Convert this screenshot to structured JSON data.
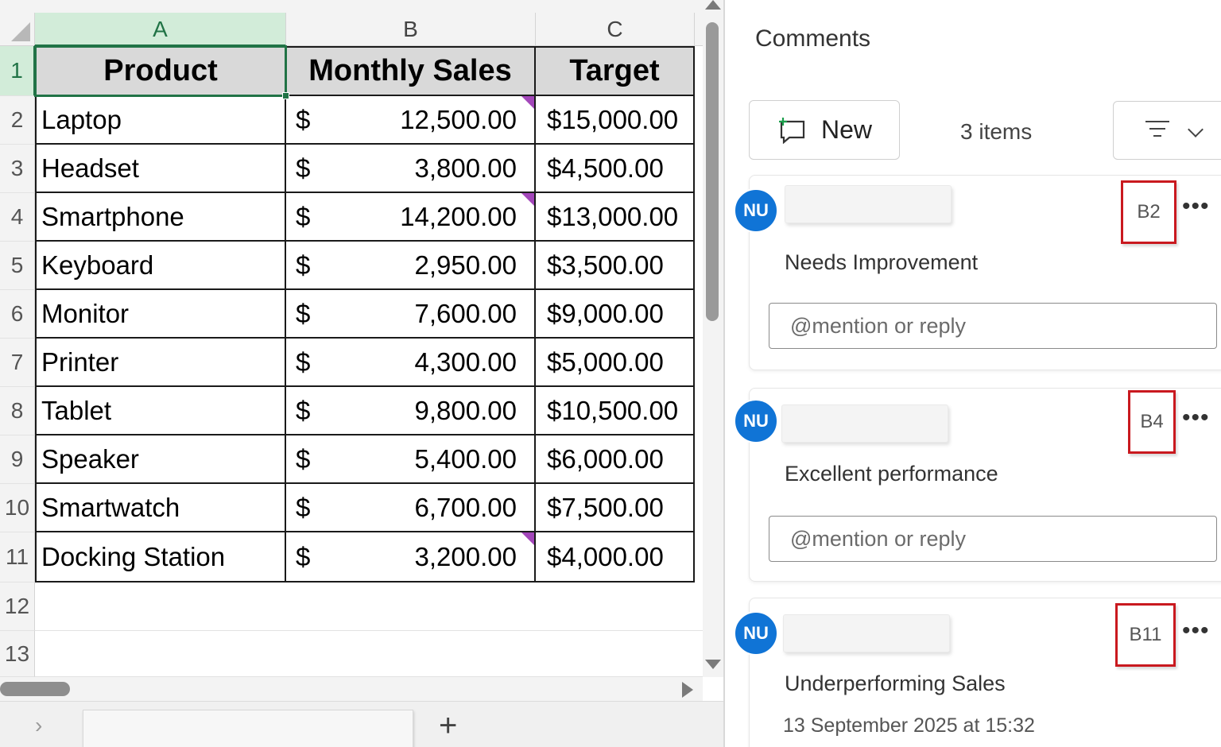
{
  "sheet": {
    "columns": [
      "A",
      "B",
      "C"
    ],
    "selected_column": "A",
    "selected_row": "1",
    "rows": [
      "1",
      "2",
      "3",
      "4",
      "5",
      "6",
      "7",
      "8",
      "9",
      "10",
      "11",
      "12",
      "13"
    ],
    "headers": [
      "Product",
      "Monthly Sales",
      "Target"
    ],
    "data": [
      {
        "product": "Laptop",
        "currency": "$",
        "sales": "12,500.00",
        "target": "$15,000.00",
        "has_comment": true
      },
      {
        "product": "Headset",
        "currency": "$",
        "sales": "3,800.00",
        "target": "$4,500.00",
        "has_comment": false
      },
      {
        "product": "Smartphone",
        "currency": "$",
        "sales": "14,200.00",
        "target": "$13,000.00",
        "has_comment": true
      },
      {
        "product": "Keyboard",
        "currency": "$",
        "sales": "2,950.00",
        "target": "$3,500.00",
        "has_comment": false
      },
      {
        "product": "Monitor",
        "currency": "$",
        "sales": "7,600.00",
        "target": "$9,000.00",
        "has_comment": false
      },
      {
        "product": "Printer",
        "currency": "$",
        "sales": "4,300.00",
        "target": "$5,000.00",
        "has_comment": false
      },
      {
        "product": "Tablet",
        "currency": "$",
        "sales": "9,800.00",
        "target": "$10,500.00",
        "has_comment": false
      },
      {
        "product": "Speaker",
        "currency": "$",
        "sales": "5,400.00",
        "target": "$6,000.00",
        "has_comment": false
      },
      {
        "product": "Smartwatch",
        "currency": "$",
        "sales": "6,700.00",
        "target": "$7,500.00",
        "has_comment": false
      },
      {
        "product": "Docking Station",
        "currency": "$",
        "sales": "3,200.00",
        "target": "$4,000.00",
        "has_comment": true
      }
    ],
    "tab_nav": "›",
    "add_sheet": "+"
  },
  "pane": {
    "title": "Comments",
    "new_label": "New",
    "item_count": "3 items",
    "comments": [
      {
        "initials": "NU",
        "ref": "B2",
        "text": "Needs Improvement",
        "reply_placeholder": "@mention or reply",
        "more": "•••"
      },
      {
        "initials": "NU",
        "ref": "B4",
        "text": "Excellent performance",
        "reply_placeholder": "@mention or reply",
        "more": "•••"
      },
      {
        "initials": "NU",
        "ref": "B11",
        "text": "Underperforming Sales",
        "timestamp": "13 September 2025 at 15:32",
        "more": "•••"
      }
    ]
  },
  "colors": {
    "accent_green": "#217346",
    "comment_flag": "#a347ba",
    "avatar_blue": "#1074d6",
    "highlight_red": "#c9191f"
  }
}
